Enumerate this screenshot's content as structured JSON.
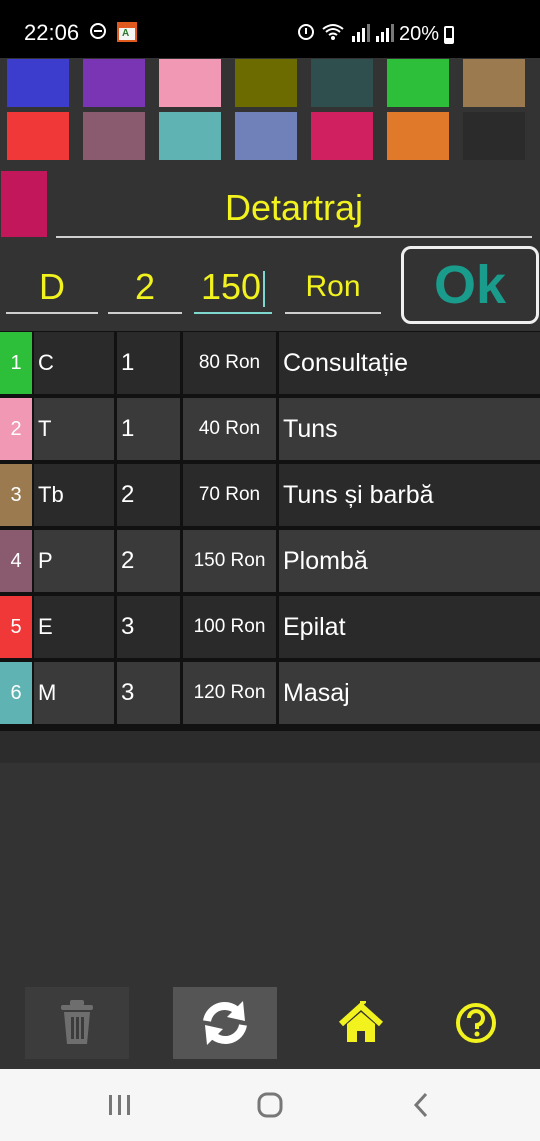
{
  "status_bar": {
    "time": "22:06",
    "battery": "20%",
    "icons": [
      "do-not-disturb-icon",
      "app-notification-icon",
      "alarm-icon",
      "wifi-icon",
      "signal-icon",
      "signal-icon",
      "battery-icon"
    ]
  },
  "palette": {
    "row1": [
      "#3c3ccd",
      "#7a35b4",
      "#f098b4",
      "#6b6b00",
      "#2f4e4e",
      "#2ebf3a",
      "#9a7a4e"
    ],
    "row2": [
      "#f03838",
      "#8a5a6e",
      "#5fb3b3",
      "#7080b8",
      "#d02060",
      "#e07a2a",
      "#2b2b2b"
    ]
  },
  "editor": {
    "selected_color": "#c2185b",
    "name": "Detartraj",
    "code": "D",
    "group": "2",
    "price": "150",
    "currency": "Ron",
    "ok_label": "Ok"
  },
  "services": [
    {
      "index": "1",
      "color": "#2ebf3a",
      "code": "C",
      "group": "1",
      "price": "80 Ron",
      "name": "Consultație"
    },
    {
      "index": "2",
      "color": "#f098b4",
      "code": "T",
      "group": "1",
      "price": "40 Ron",
      "name": "Tuns"
    },
    {
      "index": "3",
      "color": "#9a7a4e",
      "code": "Tb",
      "group": "2",
      "price": "70 Ron",
      "name": "Tuns și barbă"
    },
    {
      "index": "4",
      "color": "#8a5a6e",
      "code": "P",
      "group": "2",
      "price": "150 Ron",
      "name": "Plombă"
    },
    {
      "index": "5",
      "color": "#f03838",
      "code": "E",
      "group": "3",
      "price": "100 Ron",
      "name": "Epilat"
    },
    {
      "index": "6",
      "color": "#5fb3b3",
      "code": "M",
      "group": "3",
      "price": "120 Ron",
      "name": "Masaj"
    }
  ],
  "toolbar": {
    "accent_color": "#f2f21e",
    "icons": [
      "trash-icon",
      "refresh-icon",
      "home-icon",
      "help-icon"
    ]
  },
  "navbar": {
    "icons": [
      "recent-apps-icon",
      "home-nav-icon",
      "back-icon"
    ]
  }
}
